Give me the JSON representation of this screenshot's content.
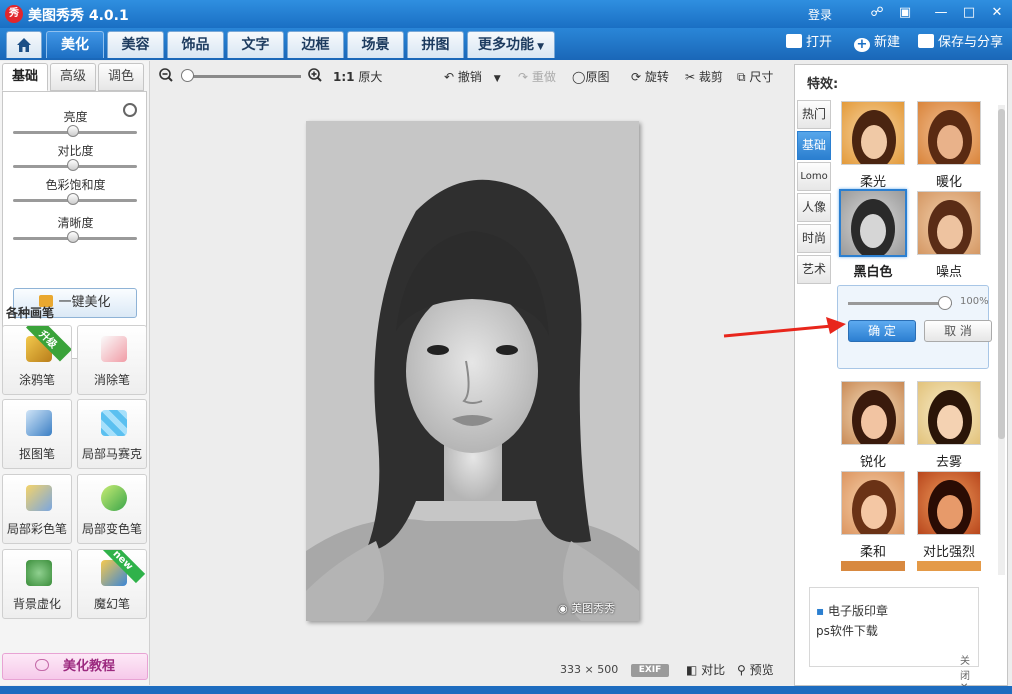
{
  "app": {
    "logo_text": "秀",
    "title": "美图秀秀 4.0.1",
    "login": "登录"
  },
  "nav": {
    "tabs": [
      "美化",
      "美容",
      "饰品",
      "文字",
      "边框",
      "场景",
      "拼图",
      "更多功能"
    ],
    "open": "打开",
    "new": "新建",
    "save_share": "保存与分享"
  },
  "left": {
    "subtabs": [
      "基础",
      "高级",
      "调色"
    ],
    "sliders": [
      "亮度",
      "对比度",
      "色彩饱和度",
      "清晰度"
    ],
    "one_click": "一键美化",
    "brush_title": "各种画笔",
    "tools": [
      "涂鸦笔",
      "消除笔",
      "抠图笔",
      "局部马赛克",
      "局部彩色笔",
      "局部变色笔",
      "背景虚化",
      "魔幻笔"
    ],
    "ribbon_upgrade": "升级",
    "ribbon_new": "new",
    "tutorial": "美化教程"
  },
  "toolbar": {
    "ratio": "1:1",
    "original_size": "原大",
    "undo": "撤销",
    "redo": "重做",
    "original": "原图",
    "rotate": "旋转",
    "crop": "裁剪",
    "size": "尺寸"
  },
  "canvas": {
    "watermark": "美图秀秀",
    "width": "333",
    "times": "×",
    "height": "500",
    "exif": "EXIF",
    "compare": "对比",
    "preview": "预览"
  },
  "right": {
    "title": "特效:",
    "vtabs": [
      "热门",
      "基础",
      "Lomo",
      "人像",
      "时尚",
      "艺术"
    ],
    "effects": [
      "柔光",
      "暖化",
      "黑白色",
      "噪点",
      "锐化",
      "去雾",
      "柔和",
      "对比强烈"
    ],
    "intensity_pct": "100%",
    "confirm": "确 定",
    "cancel": "取 消",
    "ad_lines": [
      "电子版印章",
      "ps软件下载"
    ],
    "ad_close": "关闭"
  },
  "colors": {
    "accent": "#2b7fd0",
    "title_bar": "#1a6fc4",
    "arrow": "#e8261c"
  }
}
